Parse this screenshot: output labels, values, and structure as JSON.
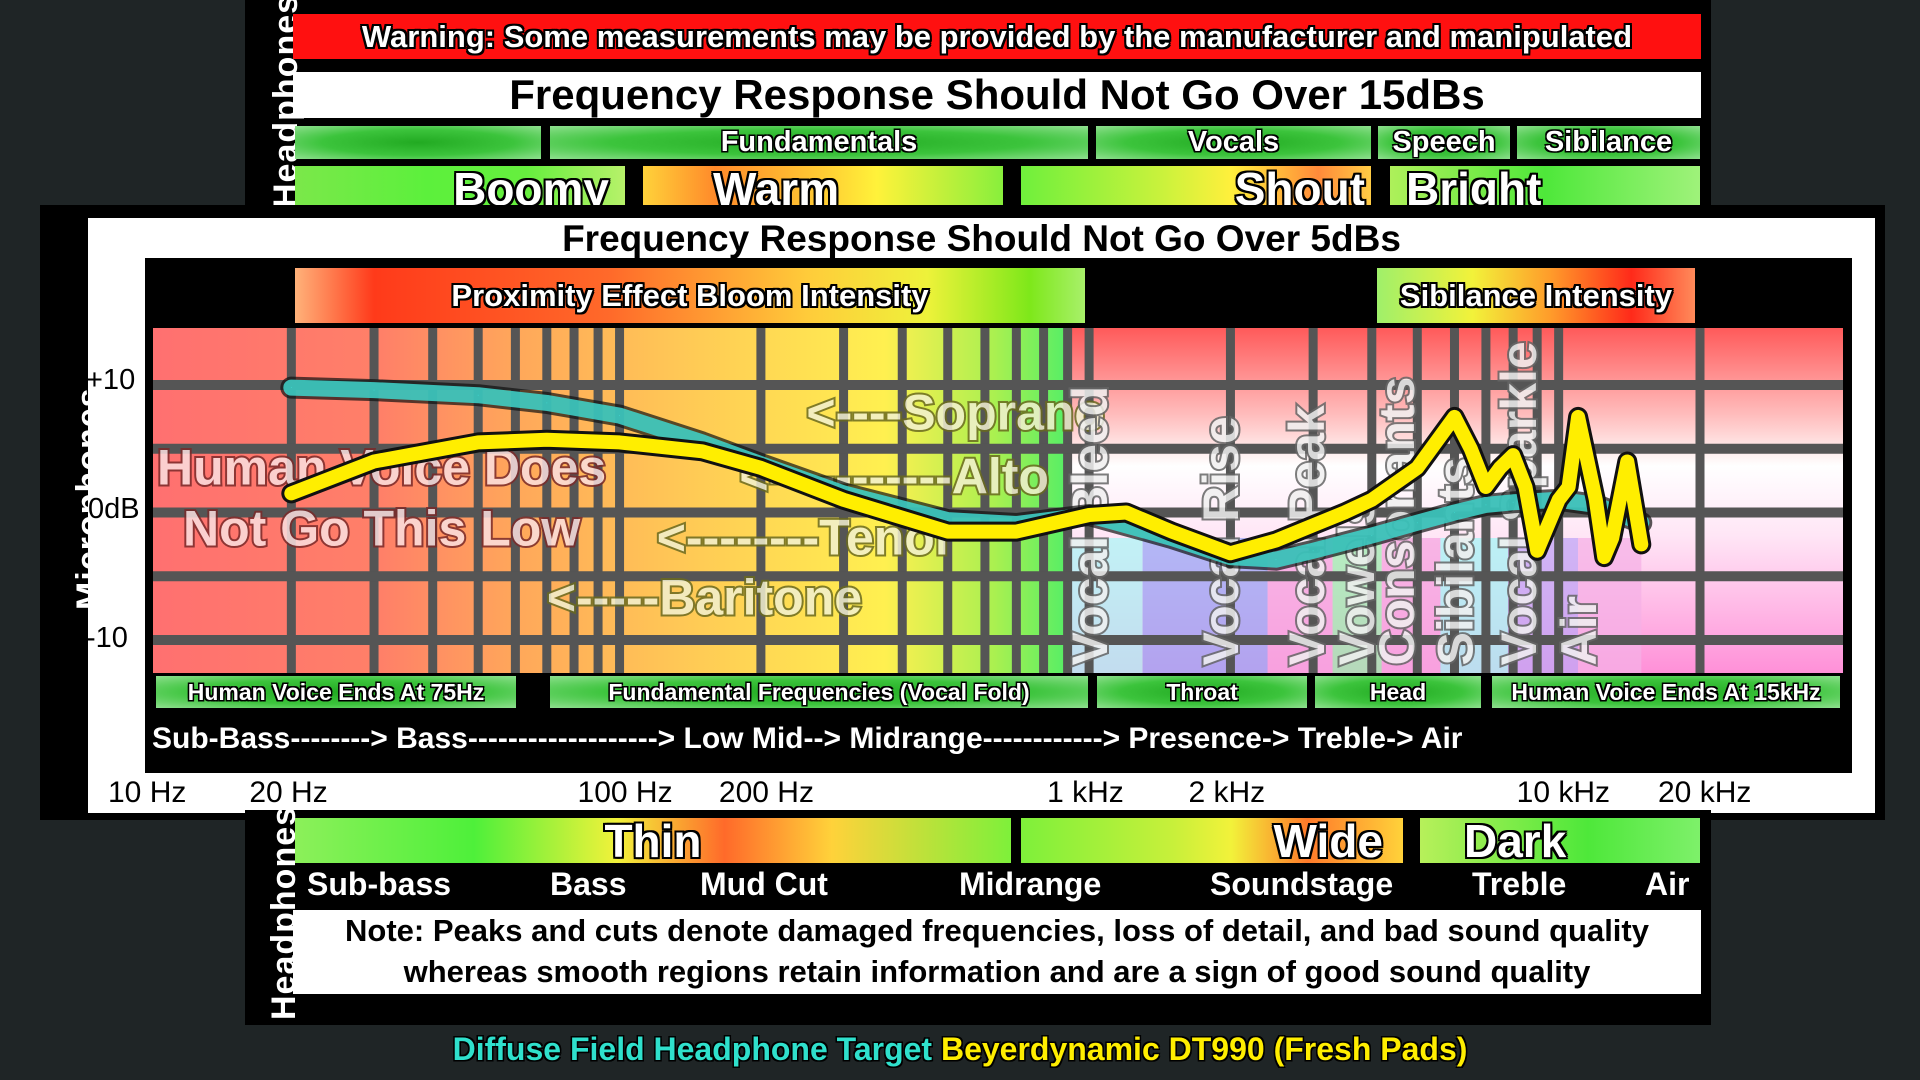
{
  "headphones_top": {
    "side_label": "Headphones",
    "warning": "Warning: Some measurements may be provided by the manufacturer and manipulated",
    "limit_title": "Frequency Response Should Not Go Over 15dBs",
    "category_bars": [
      "",
      "Fundamentals",
      "Vocals",
      "Speech",
      "Sibilance"
    ],
    "character_bars": [
      "Boomy",
      "Warm",
      "Shout",
      "Bright"
    ]
  },
  "microphones": {
    "side_label": "Microphones",
    "limit_title": "Frequency Response Should Not Go Over 5dBs",
    "intensity_bars": [
      "Proximity Effect Bloom Intensity",
      "Sibilance Intensity"
    ],
    "overlay_left": [
      "Human Voice Does",
      "Not Go This Low"
    ],
    "voice_ranges": [
      "<----Soprano",
      "<-----------Alto",
      "<--------Tenor",
      "<-----Baritone"
    ],
    "vertical_labels": [
      "Vocal Bleed",
      "Vocal Rise",
      "Vocal Peak",
      "Vowels",
      "Consonants",
      "Sibilants",
      "Vocal Sparkle",
      "Air"
    ],
    "region_bars": [
      "Human Voice Ends At 75Hz",
      "Fundamental Frequencies (Vocal Fold)",
      "Throat",
      "Head",
      "Human Voice Ends At 15kHz"
    ],
    "band_progression": "Sub-Bass--------> Bass-------------------> Low Mid--> Midrange------------> Presence-> Treble-> Air"
  },
  "headphones_bottom": {
    "side_label": "Headphones",
    "character_bars": [
      "Thin",
      "Wide",
      "Dark"
    ],
    "band_labels": [
      "Sub-bass",
      "Bass",
      "Mud Cut",
      "Midrange",
      "Soundstage",
      "Treble",
      "Air"
    ],
    "note_line1": "Note: Peaks and cuts denote damaged frequencies, loss of detail, and bad sound quality",
    "note_line2": "whereas smooth regions retain information and are a sign of good sound quality"
  },
  "legend": {
    "target_label": "Diffuse Field Headphone Target",
    "target_color": "#2fe0cc",
    "device_label": "Beyerdynamic DT990 (Fresh Pads)",
    "device_color": "#ffee00"
  },
  "chart_data": {
    "type": "line",
    "title": "Frequency Response Should Not Go Over 5dBs",
    "xlabel": "Frequency",
    "ylabel": "Microphones",
    "xscale": "log",
    "xlim": [
      10,
      30000
    ],
    "ylim": [
      -12,
      15
    ],
    "x_ticks": [
      {
        "value": 10,
        "label": "10 Hz"
      },
      {
        "value": 20,
        "label": "20 Hz"
      },
      {
        "value": 100,
        "label": "100 Hz"
      },
      {
        "value": 200,
        "label": "200 Hz"
      },
      {
        "value": 1000,
        "label": "1 kHz"
      },
      {
        "value": 2000,
        "label": "2 kHz"
      },
      {
        "value": 10000,
        "label": "10 kHz"
      },
      {
        "value": 20000,
        "label": "20 kHz"
      }
    ],
    "y_ticks": [
      {
        "value": 10,
        "label": "+10"
      },
      {
        "value": 0,
        "label": "0dB"
      },
      {
        "value": -10,
        "label": "-10"
      }
    ],
    "grid": true,
    "series": [
      {
        "name": "Diffuse Field Headphone Target",
        "color": "#3fd6cc",
        "x": [
          20,
          30,
          50,
          70,
          100,
          150,
          200,
          300,
          500,
          700,
          1000,
          1500,
          2000,
          2500,
          3000,
          4000,
          5000,
          6000,
          7000,
          8000,
          10000,
          12000,
          15000
        ],
        "y": [
          9.8,
          9.6,
          9.2,
          8.6,
          7.6,
          5.5,
          3.8,
          1.5,
          -0.6,
          -0.9,
          -0.2,
          -2.0,
          -3.5,
          -3.7,
          -3.0,
          -1.8,
          -0.8,
          0.0,
          0.6,
          0.8,
          1.0,
          0.6,
          -0.8
        ]
      },
      {
        "name": "Beyerdynamic DT990 (Fresh Pads)",
        "color": "#ffee00",
        "x": [
          20,
          30,
          50,
          70,
          100,
          150,
          200,
          300,
          500,
          700,
          1000,
          1200,
          1500,
          2000,
          2500,
          3000,
          3500,
          4000,
          5000,
          6000,
          6500,
          7000,
          7500,
          8000,
          8500,
          9000,
          10000,
          10500,
          11000,
          12000,
          12500,
          13000,
          14000,
          15000
        ],
        "y": [
          1.5,
          4.0,
          5.5,
          5.7,
          5.5,
          4.8,
          3.5,
          1.0,
          -1.5,
          -1.5,
          -0.2,
          0.0,
          -1.5,
          -3.2,
          -2.2,
          -1.0,
          0.0,
          1.0,
          3.5,
          7.5,
          5.0,
          2.0,
          3.5,
          4.5,
          2.0,
          -3.0,
          1.0,
          2.0,
          7.5,
          1.0,
          -3.5,
          -2.0,
          4.0,
          -2.5
        ]
      }
    ],
    "legend": "bottom"
  }
}
